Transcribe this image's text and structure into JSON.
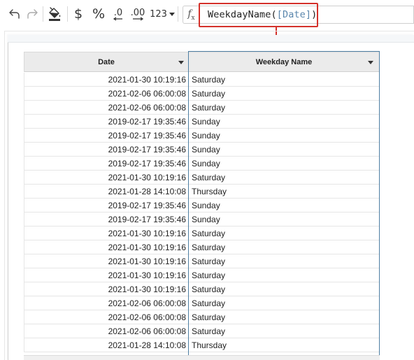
{
  "toolbar": {
    "undo_icon": "undo-arrow-icon",
    "redo_icon": "redo-arrow-icon",
    "fill_icon": "paint-bucket-icon",
    "currency_label": "$",
    "percent_label": "%",
    "decrease_decimals_label": ".0",
    "increase_decimals_label": ".00",
    "number_format_label": "123"
  },
  "formula_bar": {
    "fx_label": "f",
    "fx_sub": "x",
    "function_name": "WeekdayName(",
    "argument": "[Date]",
    "close_paren": ")"
  },
  "colors": {
    "highlight": "#d4312b",
    "selection": "#4e7fa3",
    "reference": "#5a86ad"
  },
  "table": {
    "columns": [
      "Date",
      "Weekday Name"
    ],
    "rows": [
      [
        "2021-01-30 10:19:16",
        "Saturday"
      ],
      [
        "2021-02-06 06:00:08",
        "Saturday"
      ],
      [
        "2021-02-06 06:00:08",
        "Saturday"
      ],
      [
        "2019-02-17 19:35:46",
        "Sunday"
      ],
      [
        "2019-02-17 19:35:46",
        "Sunday"
      ],
      [
        "2019-02-17 19:35:46",
        "Sunday"
      ],
      [
        "2019-02-17 19:35:46",
        "Sunday"
      ],
      [
        "2021-01-30 10:19:16",
        "Saturday"
      ],
      [
        "2021-01-28 14:10:08",
        "Thursday"
      ],
      [
        "2019-02-17 19:35:46",
        "Sunday"
      ],
      [
        "2019-02-17 19:35:46",
        "Sunday"
      ],
      [
        "2021-01-30 10:19:16",
        "Saturday"
      ],
      [
        "2021-01-30 10:19:16",
        "Saturday"
      ],
      [
        "2021-01-30 10:19:16",
        "Saturday"
      ],
      [
        "2021-01-30 10:19:16",
        "Saturday"
      ],
      [
        "2021-01-30 10:19:16",
        "Saturday"
      ],
      [
        "2021-02-06 06:00:08",
        "Saturday"
      ],
      [
        "2021-02-06 06:00:08",
        "Saturday"
      ],
      [
        "2021-02-06 06:00:08",
        "Saturday"
      ],
      [
        "2021-01-28 14:10:08",
        "Thursday"
      ]
    ]
  }
}
